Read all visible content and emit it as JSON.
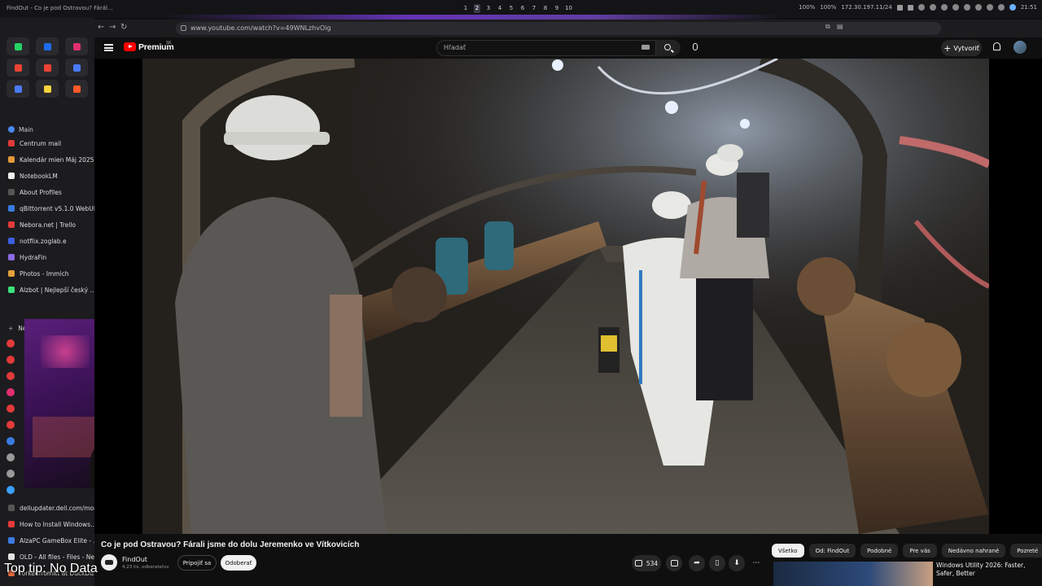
{
  "os": {
    "window_title": "FindOut - Co je pod Ostravou? Fárál…",
    "workspaces": [
      "1",
      "2",
      "3",
      "4",
      "5",
      "6",
      "7",
      "8",
      "9",
      "10"
    ],
    "active_workspace": "2",
    "status": {
      "battery": "100%",
      "brightness": "100%",
      "ip": "172.30.197.11/24",
      "clock": "21:51"
    }
  },
  "browser": {
    "url": "www.youtube.com/watch?v=49WNLzhvOig",
    "sidebar": {
      "pinned_colors": [
        "#25d366",
        "#1e6bf0",
        "#e1306c",
        "#cccccc",
        "#ea4335",
        "#ea4335",
        "#4a7bf7",
        "#3aa0ff",
        "#4a7bf7",
        "#f7d33a",
        "#ff5a2b",
        "#888888"
      ],
      "section": "Main",
      "items": [
        {
          "label": "Centrum mail",
          "color": "#e23a3a"
        },
        {
          "label": "Kalendár mien Máj 2025",
          "color": "#e29a3a"
        },
        {
          "label": "NotebookLM",
          "color": "#eeeeee"
        },
        {
          "label": "About Profiles",
          "color": "#555555"
        },
        {
          "label": "qBittorrent v5.1.0 WebUI",
          "color": "#3a7be2"
        },
        {
          "label": "Nebora.net | Trello",
          "color": "#e23a3a"
        },
        {
          "label": "notflix.zoglab.e",
          "color": "#3a5ee2"
        },
        {
          "label": "HydraFin",
          "color": "#8a6ae2"
        },
        {
          "label": "Photos - Immich",
          "color": "#e2a03a"
        },
        {
          "label": "Alzbot | Nejlepší český …",
          "color": "#3ae27a"
        }
      ],
      "new_tab": "New Tab",
      "small_tab_colors": [
        "#e23a3a",
        "#e23a3a",
        "#e23a3a",
        "#e1306c",
        "#e23a3a",
        "#e23a3a",
        "#3a7be2",
        "#999999",
        "#999999",
        "#3aa0ff"
      ],
      "items2": [
        {
          "label": "dellupdater.dell.com/mon…",
          "color": "#555555"
        },
        {
          "label": "How to Install Windows…",
          "color": "#e23a3a"
        },
        {
          "label": "AlzaPC GameBox Elite - …",
          "color": "#3a7be2"
        },
        {
          "label": "OLD - All files - Files - Ne…",
          "color": "#e2e2e2"
        },
        {
          "label": "forkedfromltt at DuckDu…",
          "color": "#e26a3a"
        }
      ]
    }
  },
  "youtube": {
    "brand": "Premium",
    "brand_sup": "SK",
    "search_placeholder": "Hľadať",
    "create_label": "Vytvoriť",
    "video_title": "Co je pod Ostravou? Fárali jsme do dolu Jeremenko ve Vítkovicích",
    "channel": {
      "name": "FindOut",
      "subscribers": "4,23 tis. odberateľov",
      "join_label": "Pripojiť sa",
      "unsub_label": "Odoberať"
    },
    "likes": "534",
    "chips": [
      "Všetko",
      "Od: FindOut",
      "Podobné",
      "Pre vás",
      "Nedávno nahrané",
      "Pozreté"
    ],
    "active_chip": "Všetko",
    "recommendation": {
      "title": "Windows Utility 2026: Faster, Safer, Better"
    }
  },
  "overlay": {
    "top_tip": "Top tip: No Data"
  }
}
